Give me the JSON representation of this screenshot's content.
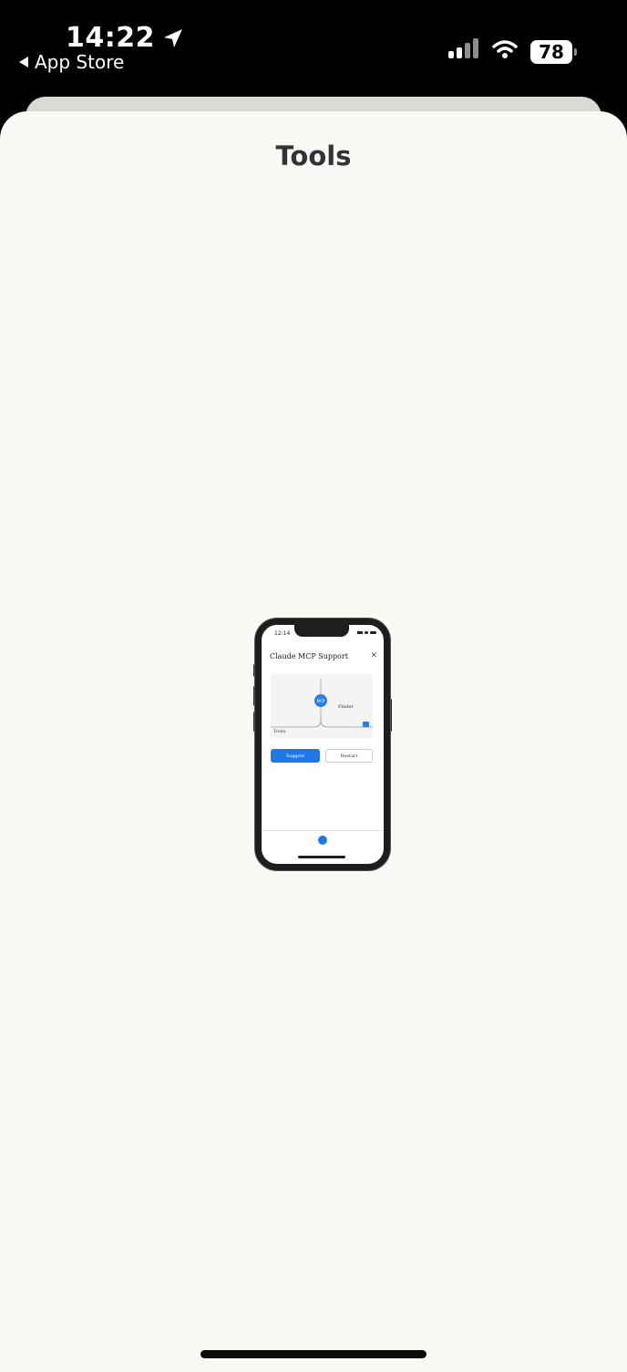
{
  "status_bar": {
    "time": "14:22",
    "back_label": "App Store",
    "battery_level": "78"
  },
  "sheet": {
    "title": "Tools"
  },
  "phone_preview": {
    "time": "12:14",
    "title": "Claude MCP Support",
    "close_glyph": "✕",
    "node_label": "MCP",
    "right_label": "Finder",
    "bottom_label": "Tools",
    "primary_button": "Suggest",
    "secondary_button": "Restart"
  },
  "colors": {
    "status_bar_bg": "#000000",
    "sheet_bg": "#faf9f6",
    "accent": "#1f78e6"
  }
}
